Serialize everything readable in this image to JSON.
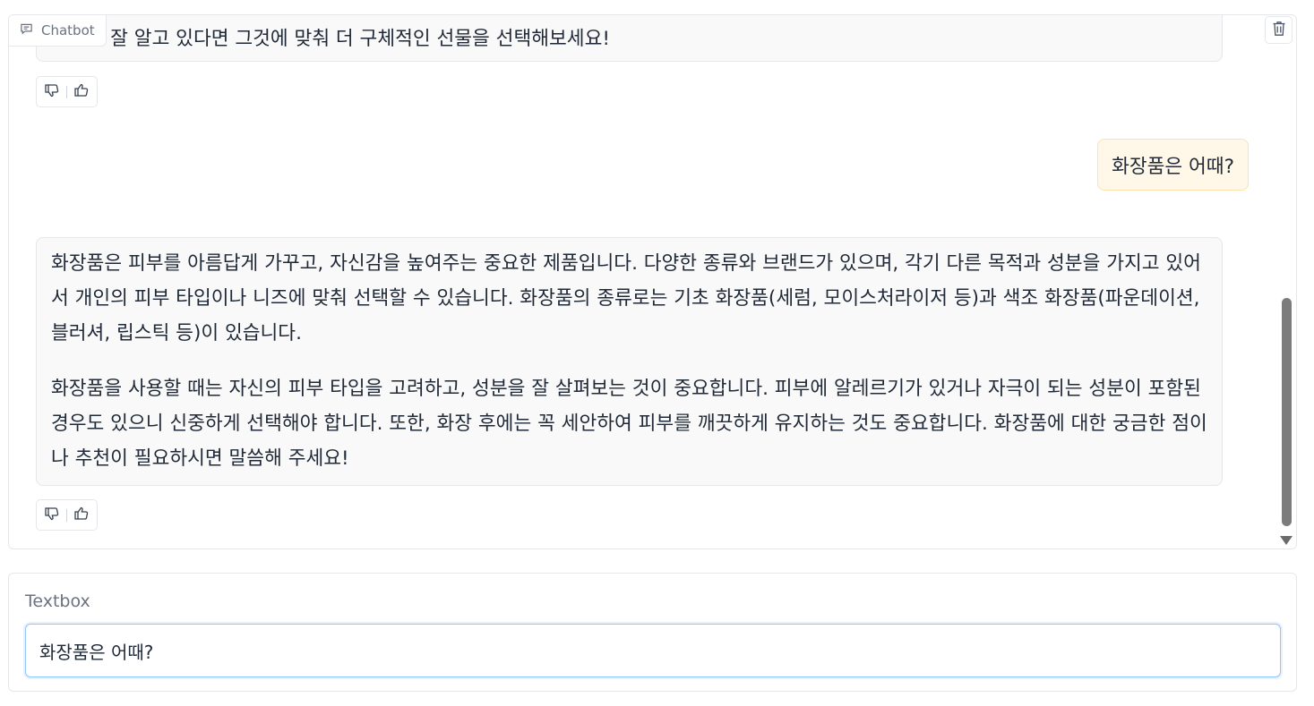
{
  "chatbot": {
    "label": "Chatbot",
    "messages": [
      {
        "role": "bot",
        "paragraphs": [
          "취향을 잘 알고 있다면 그것에 맞춰 더 구체적인 선물을 선택해보세요!"
        ]
      },
      {
        "role": "user",
        "text": "화장품은 어때?"
      },
      {
        "role": "bot",
        "paragraphs": [
          "화장품은 피부를 아름답게 가꾸고, 자신감을 높여주는 중요한 제품입니다. 다양한 종류와 브랜드가 있으며, 각기 다른 목적과 성분을 가지고 있어서 개인의 피부 타입이나 니즈에 맞춰 선택할 수 있습니다. 화장품의 종류로는 기초 화장품(세럼, 모이스처라이저 등)과 색조 화장품(파운데이션, 블러셔, 립스틱 등)이 있습니다.",
          "화장품을 사용할 때는 자신의 피부 타입을 고려하고, 성분을 잘 살펴보는 것이 중요합니다. 피부에 알레르기가 있거나 자극이 되는 성분이 포함된 경우도 있으니 신중하게 선택해야 합니다. 또한, 화장 후에는 꼭 세안하여 피부를 깨끗하게 유지하는 것도 중요합니다. 화장품에 대한 궁금한 점이나 추천이 필요하시면 말씀해 주세요!"
        ]
      }
    ]
  },
  "textbox": {
    "label": "Textbox",
    "value": "화장품은 어때?"
  },
  "colors": {
    "user_bubble_bg": "#fff7e8",
    "bot_bubble_bg": "#f9f9f9",
    "input_focus_border": "#93c5fd"
  },
  "icons": {
    "chatbot": "chat-bubble-icon",
    "clear": "trash-icon",
    "dislike": "thumbs-down-icon",
    "like": "thumbs-up-icon"
  }
}
